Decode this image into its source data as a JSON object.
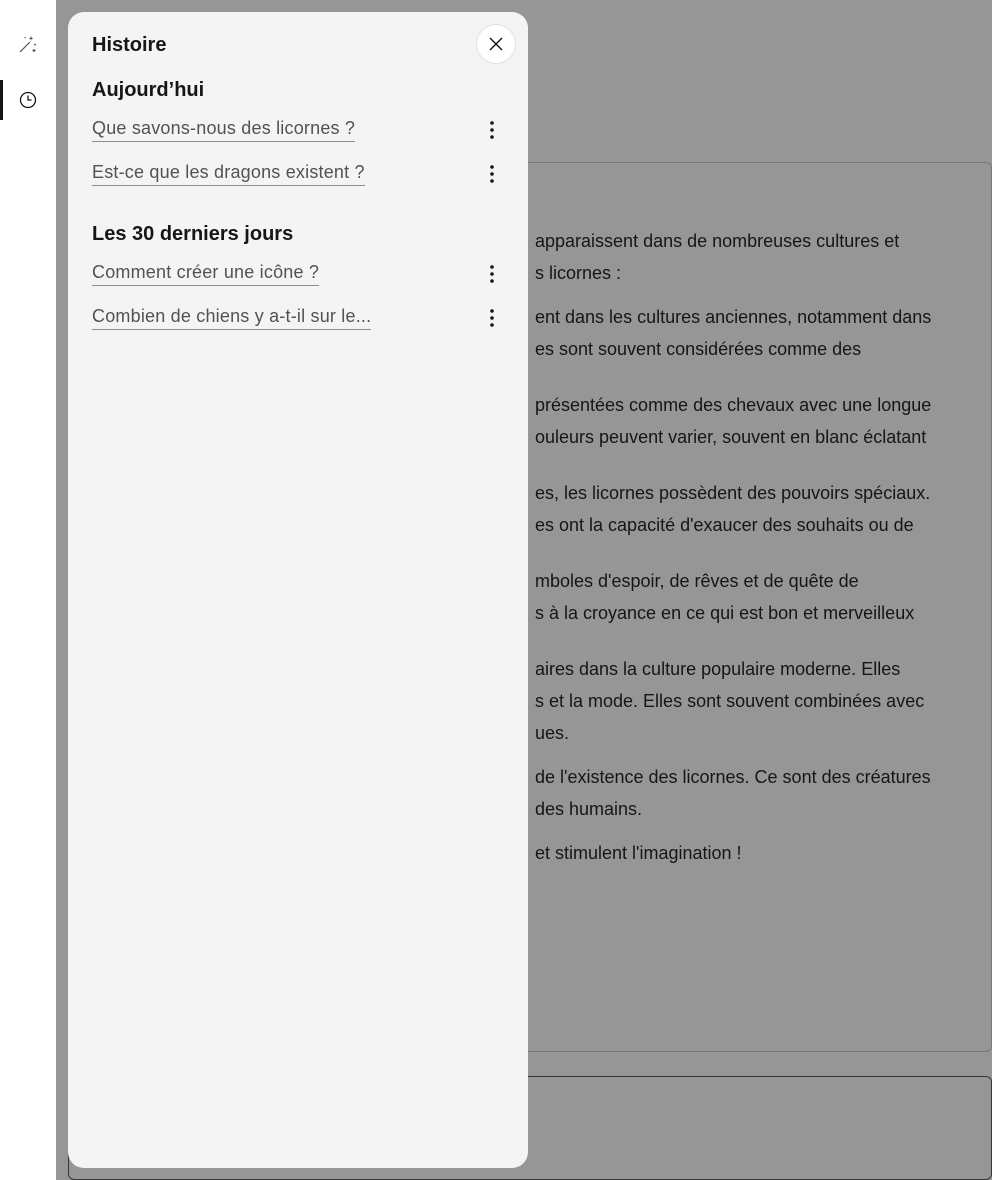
{
  "sidebar": {
    "items": [
      {
        "icon": "magic-wand-icon",
        "active": false
      },
      {
        "icon": "history-clock-icon",
        "active": true
      }
    ]
  },
  "answer": {
    "lines": [
      "apparaissent dans de nombreuses cultures et",
      "s licornes :",
      "",
      "ent dans les cultures anciennes, notamment dans",
      "es sont souvent considérées comme des",
      "",
      "",
      "présentées comme des chevaux avec une longue",
      "ouleurs peuvent varier, souvent en blanc éclatant",
      "",
      "",
      "es, les licornes possèdent des pouvoirs spéciaux.",
      "es ont la capacité d'exaucer des souhaits ou de",
      "",
      "",
      "mboles d'espoir, de rêves et de quête de",
      "s à la croyance en ce qui est bon et merveilleux",
      "",
      "",
      "aires dans la culture populaire moderne. Elles",
      "s et la mode. Elles sont souvent combinées avec",
      "ues.",
      "",
      "de l'existence des licornes. Ce sont des créatures",
      "des humains.",
      "",
      "et stimulent l'imagination !"
    ]
  },
  "history_panel": {
    "title": "Histoire",
    "close_label": "Fermer",
    "sections": [
      {
        "title": "Aujourd’hui",
        "items": [
          {
            "label": "Que savons-nous des licornes ?"
          },
          {
            "label": "Est-ce que les dragons existent ?"
          }
        ]
      },
      {
        "title": "Les 30 derniers jours",
        "items": [
          {
            "label": "Comment créer une icône ?"
          },
          {
            "label": "Combien de chiens y a-t-il sur le..."
          }
        ]
      }
    ]
  }
}
